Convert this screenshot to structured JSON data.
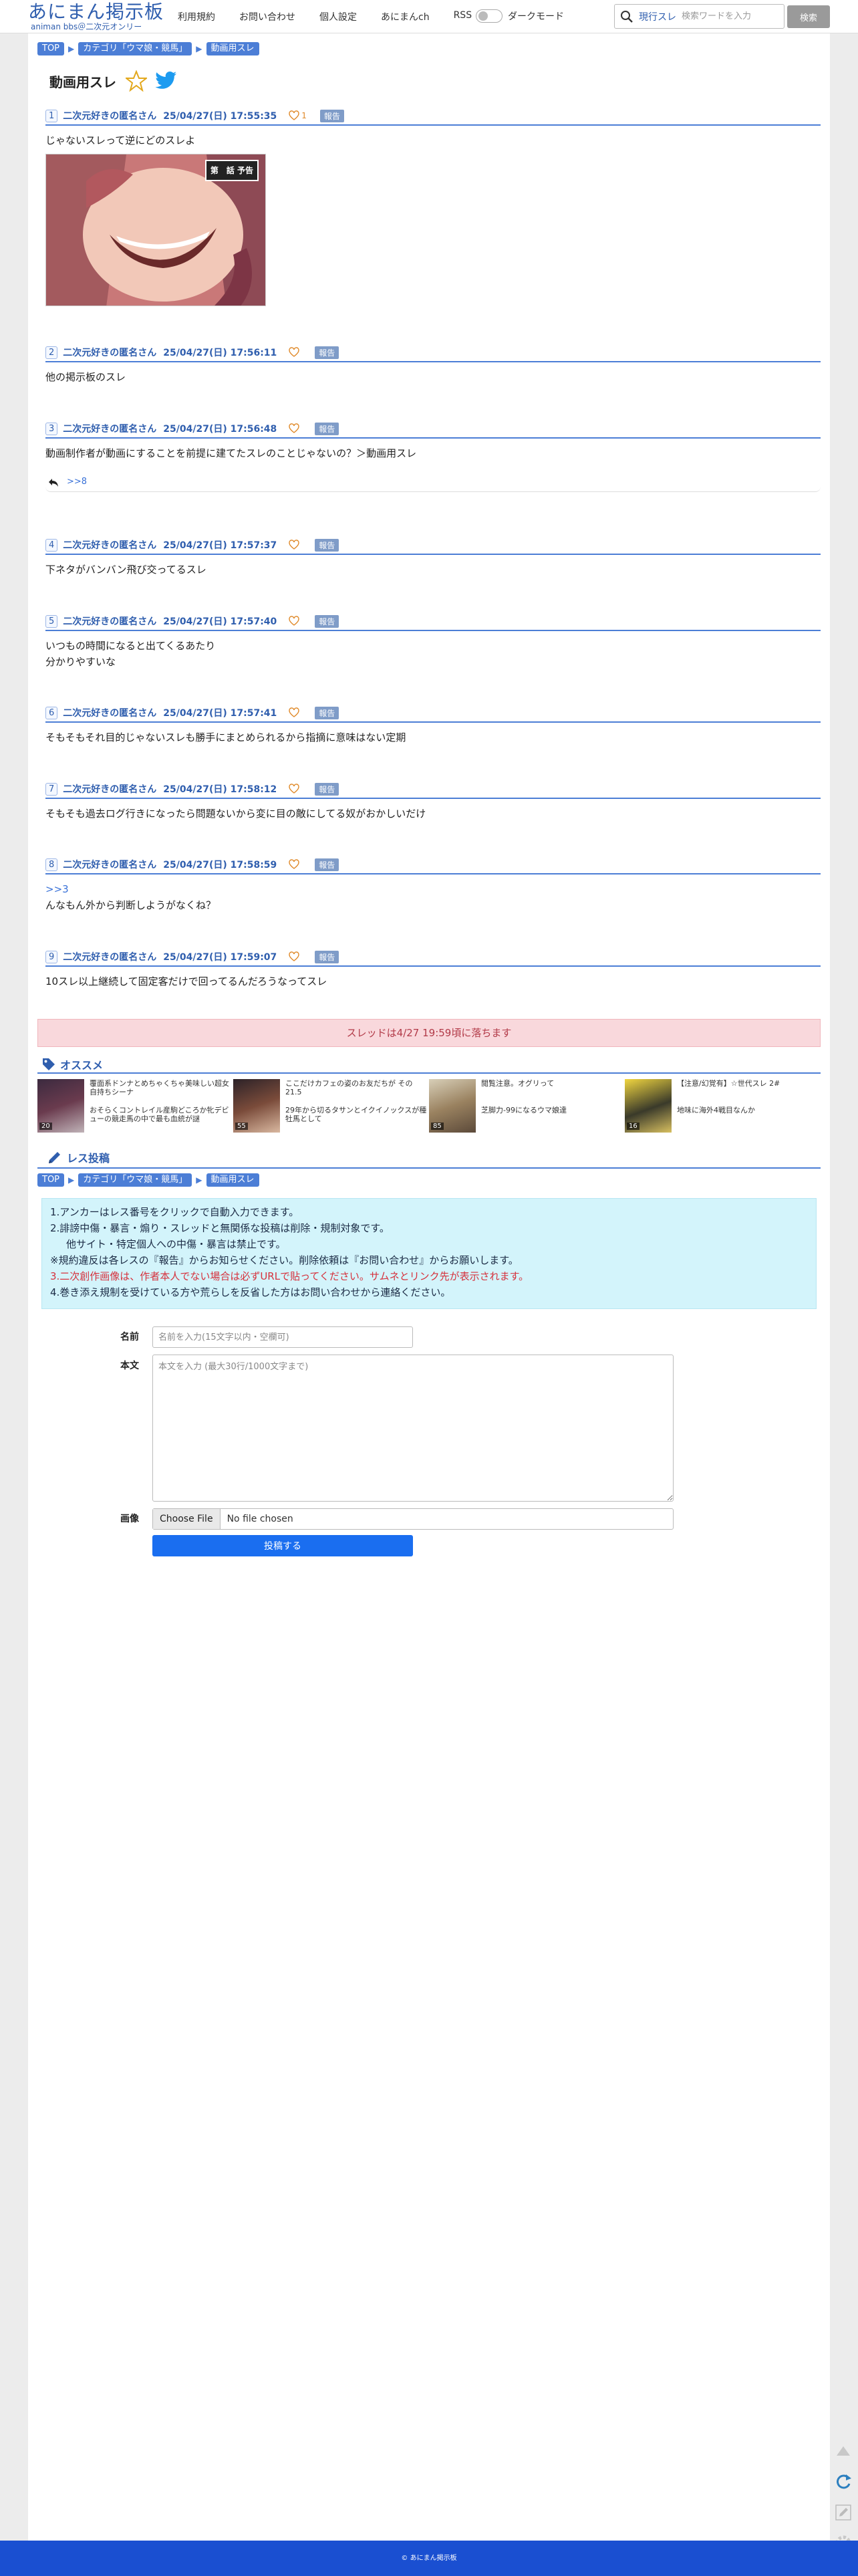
{
  "header": {
    "logo_main": "あにまん掲示板",
    "logo_sub": "animan bbs＠二次元オンリー",
    "nav": [
      "利用規約",
      "お問い合わせ",
      "個人設定",
      "あにまんch",
      "RSS"
    ],
    "dark_mode_label": "ダークモード",
    "search_scope": "現行スレ",
    "search_placeholder": "検索ワードを入力",
    "search_button": "検索"
  },
  "breadcrumb": [
    "TOP",
    "カテゴリ「ウマ娘・競馬」",
    "動画用スレ"
  ],
  "thread": {
    "title": "動画用スレ",
    "posts": [
      {
        "num": "1",
        "name": "二次元好きの匿名さん",
        "date": "25/04/27(日) 17:55:35",
        "likes": "1",
        "report": "報告",
        "body": [
          "じゃないスレって逆にどのスレよ"
        ],
        "image_label": "第　話 予告"
      },
      {
        "num": "2",
        "name": "二次元好きの匿名さん",
        "date": "25/04/27(日) 17:56:11",
        "likes": "",
        "report": "報告",
        "body": [
          "他の掲示板のスレ"
        ]
      },
      {
        "num": "3",
        "name": "二次元好きの匿名さん",
        "date": "25/04/27(日) 17:56:48",
        "likes": "",
        "report": "報告",
        "body": [
          "動画制作者が動画にすることを前提に建てたスレのことじゃないの？＞動画用スレ"
        ],
        "replies": ">>8"
      },
      {
        "num": "4",
        "name": "二次元好きの匿名さん",
        "date": "25/04/27(日) 17:57:37",
        "likes": "",
        "report": "報告",
        "body": [
          "下ネタがバンバン飛び交ってるスレ"
        ]
      },
      {
        "num": "5",
        "name": "二次元好きの匿名さん",
        "date": "25/04/27(日) 17:57:40",
        "likes": "",
        "report": "報告",
        "body": [
          "いつもの時間になると出てくるあたり",
          "分かりやすいな"
        ]
      },
      {
        "num": "6",
        "name": "二次元好きの匿名さん",
        "date": "25/04/27(日) 17:57:41",
        "likes": "",
        "report": "報告",
        "body": [
          "そもそもそれ目的じゃないスレも勝手にまとめられるから指摘に意味はない定期"
        ]
      },
      {
        "num": "7",
        "name": "二次元好きの匿名さん",
        "date": "25/04/27(日) 17:58:12",
        "likes": "",
        "report": "報告",
        "body": [
          "そもそも過去ログ行きになったら問題ないから変に目の敵にしてる奴がおかしいだけ"
        ]
      },
      {
        "num": "8",
        "name": "二次元好きの匿名さん",
        "date": "25/04/27(日) 17:58:59",
        "likes": "",
        "report": "報告",
        "anchor": ">>3",
        "body": [
          "んなもん外から判断しようがなくね？"
        ]
      },
      {
        "num": "9",
        "name": "二次元好きの匿名さん",
        "date": "25/04/27(日) 17:59:07",
        "likes": "",
        "report": "報告",
        "body": [
          "10スレ以上継続して固定客だけで回ってるんだろうなってスレ"
        ]
      }
    ]
  },
  "drop_notice": "スレッドは4/27 19:59頃に落ちます",
  "recommend": {
    "title": "オススメ",
    "items": [
      {
        "text": "覆面系ドンナとめちゃくちゃ美味しい超女自持ちシーナ",
        "count": "20"
      },
      {
        "text": "ここだけカフェの姿のお友だちが その21.5",
        "count": "55"
      },
      {
        "text": "閲覧注意。オグリって",
        "count": "85"
      },
      {
        "text": "【注意/幻覚有】☆世代スレ 2#",
        "count": "16"
      },
      {
        "text": "おそらくコントレイル産駒どころか牝デビューの競走馬の中で最も血統が謎",
        "count": "63"
      },
      {
        "text": "29年から切るタサンとイクイノックスが種牡馬として",
        "count": "54"
      },
      {
        "text": "芝脚力-99になるウマ娘達",
        "count": "87"
      },
      {
        "text": "地味に海外4戦目なんか",
        "count": "49"
      }
    ]
  },
  "post_form": {
    "title": "レス投稿",
    "rules": [
      "1.アンカーはレス番号をクリックで自動入力できます。",
      "2.誹謗中傷・暴言・煽り・スレッドと無関係な投稿は削除・規制対象です。",
      "他サイト・特定個人への中傷・暴言は禁止です。",
      "※規約違反は各レスの『報告』からお知らせください。削除依頼は『お問い合わせ』からお願いします。",
      "3.二次創作画像は、作者本人でない場合は必ずURLで貼ってください。サムネとリンク先が表示されます。",
      "4.巻き添え規制を受けている方や荒らしを反省した方はお問い合わせから連絡ください。"
    ],
    "name_label": "名前",
    "name_placeholder": "名前を入力(15文字以内・空欄可)",
    "body_label": "本文",
    "body_placeholder": "本文を入力 (最大30行/1000文字まで)",
    "image_label": "画像",
    "file_button": "Choose File",
    "file_status": "No file chosen",
    "submit": "投稿する"
  },
  "footer": "© あにまん掲示板",
  "colors": {
    "accent": "#4c7ed6",
    "brand": "#2f5eae",
    "footer": "#1a4fd1",
    "notice_bg": "#f9d8dc",
    "rules_bg": "#d3f4fb"
  }
}
